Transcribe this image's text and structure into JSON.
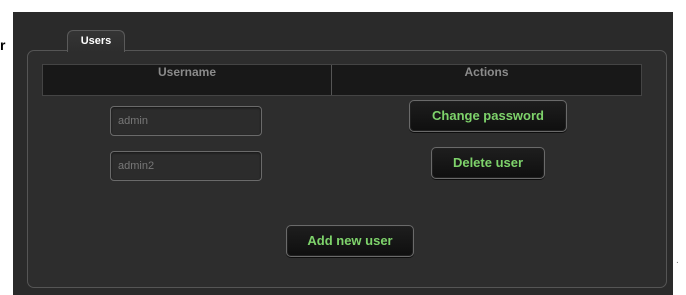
{
  "tab": {
    "label": "Users"
  },
  "table": {
    "columns": [
      "Username",
      "Actions"
    ]
  },
  "users": [
    {
      "username": "admin"
    },
    {
      "username": "admin2"
    }
  ],
  "actions": {
    "change_password": "Change password",
    "delete_user": "Delete user",
    "add_new_user": "Add new user"
  },
  "page": {
    "left_char": "r",
    "right_char": "."
  },
  "colors": {
    "panel_background": "#2a2a2a",
    "header_background": "#181818",
    "button_text": "#7ed36b",
    "input_border": "#6a6a6a"
  }
}
